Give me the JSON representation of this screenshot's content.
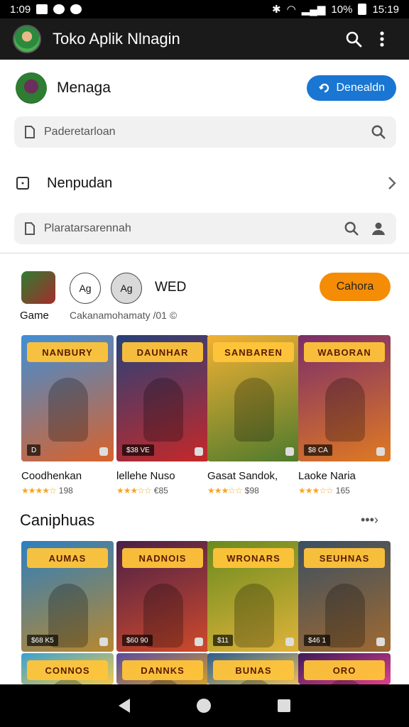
{
  "status": {
    "time_left": "1:09",
    "battery": "10%",
    "time_right": "15:19"
  },
  "appbar": {
    "title": "Toko Aplik Nlnagin"
  },
  "account": {
    "name": "Menaga",
    "button": "Denealdn"
  },
  "search1": {
    "placeholder": "Paderetarloan"
  },
  "nav_row": {
    "label": "Nenpudan"
  },
  "search2": {
    "placeholder": "Plaratarsarennah"
  },
  "game_section": {
    "label": "Game",
    "circle1": "Ag",
    "circle2": "Ag",
    "wed": "WED",
    "subtitle": "Cakanamohamaty /01 ©",
    "button": "Cahora"
  },
  "games_row1": [
    {
      "banner": "NANBURY",
      "tag": "D",
      "title": "Coodhenkan",
      "stars": "★★★★☆",
      "rating": "198",
      "colors": [
        "#3f8fd8",
        "#d9622b"
      ]
    },
    {
      "banner": "DAUNHAR",
      "tag": "$38 VE",
      "title": "lellehe Nuso",
      "stars": "★★★☆☆",
      "rating": "€85",
      "colors": [
        "#27417a",
        "#c62828"
      ]
    },
    {
      "banner": "SANBAREN",
      "tag": "",
      "title": "Gasat Sandok,",
      "stars": "★★★☆☆",
      "rating": "$98",
      "colors": [
        "#f2b134",
        "#4e7a2d"
      ]
    },
    {
      "banner": "WABORAN",
      "tag": "$8 CA",
      "title": "Laoke Naria",
      "stars": "★★★☆☆",
      "rating": "165",
      "colors": [
        "#7b2d6b",
        "#e07a22"
      ]
    }
  ],
  "section2": {
    "title": "Caniphuas",
    "more": "•••›"
  },
  "games_row2": [
    {
      "banner": "AUMAS",
      "tag": "$68 K5",
      "colors": [
        "#2d7fc0",
        "#b8882e"
      ]
    },
    {
      "banner": "NADNOIS",
      "tag": "$60 90",
      "colors": [
        "#4a2048",
        "#d04a2a"
      ]
    },
    {
      "banner": "WRONARS",
      "tag": "$11",
      "colors": [
        "#6a8a1e",
        "#e0b43a"
      ]
    },
    {
      "banner": "SEUHNAS",
      "tag": "$46 1",
      "colors": [
        "#3a4f63",
        "#a06a30"
      ]
    }
  ],
  "games_row3": [
    {
      "banner": "CONNOS",
      "colors": [
        "#3aa0d0",
        "#f2c94c"
      ]
    },
    {
      "banner": "DANNKS",
      "colors": [
        "#5a4aa0",
        "#d1a030"
      ]
    },
    {
      "banner": "BUNAS",
      "colors": [
        "#2d5c8c",
        "#e8c060"
      ]
    },
    {
      "banner": "ORO",
      "colors": [
        "#3b1a5a",
        "#e04090"
      ]
    }
  ]
}
